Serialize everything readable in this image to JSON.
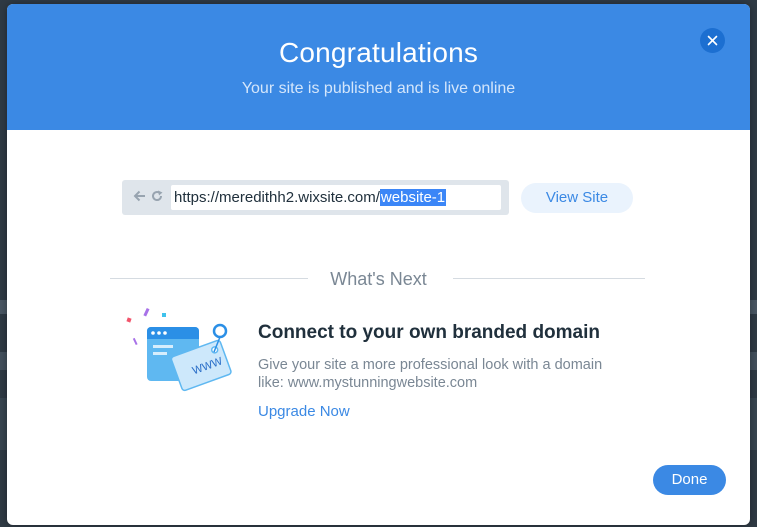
{
  "header": {
    "title": "Congratulations",
    "subtitle": "Your site is published and is live online"
  },
  "url_bar": {
    "url_base": "https://meredithh2.wixsite.com/",
    "url_selected": "website-1"
  },
  "actions": {
    "view_site_label": "View Site",
    "done_label": "Done"
  },
  "whats_next": {
    "heading": "What's Next",
    "offer_title": "Connect to your own branded domain",
    "offer_description_line1": "Give your site a more professional look with a domain",
    "offer_description_line2": "like: www.mystunningwebsite.com",
    "cta_label": "Upgrade Now",
    "illustration_tag_text": "WWW"
  },
  "icons": {
    "close": "close-icon",
    "back": "back-arrow-icon",
    "refresh": "refresh-icon",
    "domain": "domain-tag-illustration"
  },
  "colors": {
    "brand_blue": "#3b89e4",
    "close_button": "#1c6fd1",
    "text_dark": "#20303c",
    "text_muted": "#7a8794",
    "selection": "#3b86f7"
  }
}
